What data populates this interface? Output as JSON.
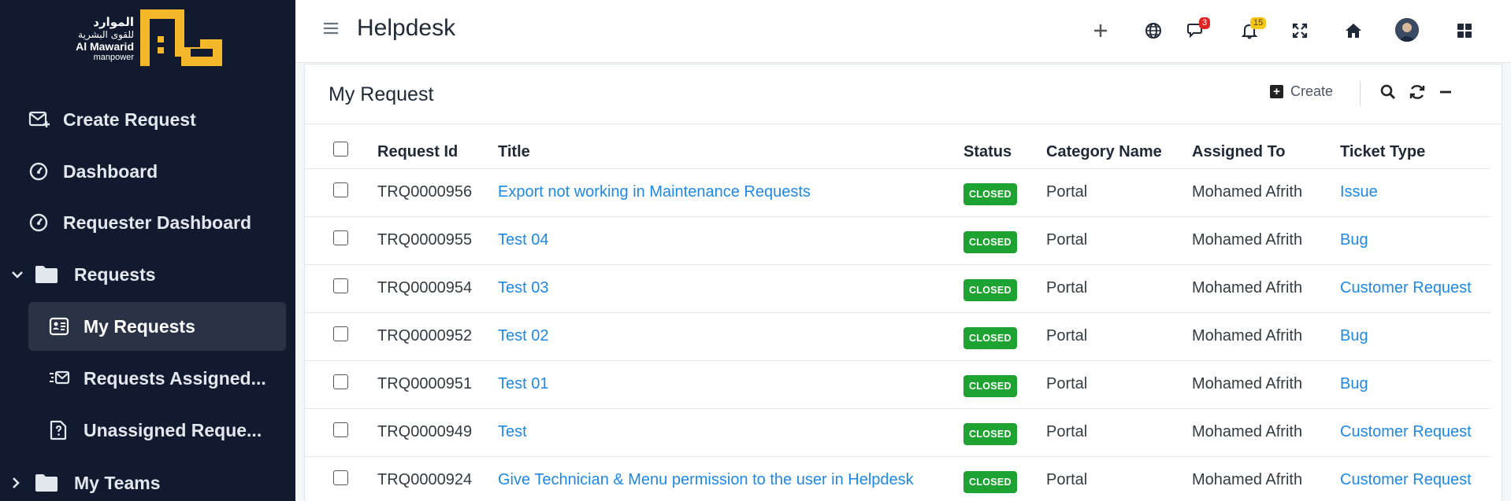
{
  "brand": {
    "arabic_line1": "الموارد",
    "arabic_line2": "للقوى البشرية",
    "english_line1": "Al Mawarid",
    "english_line2": "manpower",
    "color": "#f5b72a"
  },
  "sidebar": {
    "items": [
      {
        "label": "Create Request",
        "icon": "mail-plus-icon"
      },
      {
        "label": "Dashboard",
        "icon": "gauge-icon"
      },
      {
        "label": "Requester Dashboard",
        "icon": "gauge-icon"
      },
      {
        "label": "Requests",
        "icon": "folder-icon",
        "expanded": true
      },
      {
        "label": "My Requests",
        "icon": "id-card-icon",
        "active": true
      },
      {
        "label": "Requests Assigned...",
        "icon": "mail-fast-icon"
      },
      {
        "label": "Unassigned Reque...",
        "icon": "file-question-icon"
      },
      {
        "label": "My Teams",
        "icon": "folder-icon",
        "expanded": false
      }
    ]
  },
  "header": {
    "title": "Helpdesk",
    "messages_count": "3",
    "notifications_count": "15"
  },
  "card": {
    "title": "My Request",
    "create_label": "Create"
  },
  "table": {
    "columns": [
      "Request Id",
      "Title",
      "Status",
      "Category Name",
      "Assigned To",
      "Ticket Type"
    ],
    "rows": [
      {
        "id": "TRQ0000956",
        "title": "Export not working in Maintenance Requests",
        "status": "CLOSED",
        "category": "Portal",
        "assigned": "Mohamed Afrith",
        "type": "Issue"
      },
      {
        "id": "TRQ0000955",
        "title": "Test 04",
        "status": "CLOSED",
        "category": "Portal",
        "assigned": "Mohamed Afrith",
        "type": "Bug"
      },
      {
        "id": "TRQ0000954",
        "title": "Test 03",
        "status": "CLOSED",
        "category": "Portal",
        "assigned": "Mohamed Afrith",
        "type": "Customer Request"
      },
      {
        "id": "TRQ0000952",
        "title": "Test 02",
        "status": "CLOSED",
        "category": "Portal",
        "assigned": "Mohamed Afrith",
        "type": "Bug"
      },
      {
        "id": "TRQ0000951",
        "title": "Test 01",
        "status": "CLOSED",
        "category": "Portal",
        "assigned": "Mohamed Afrith",
        "type": "Bug"
      },
      {
        "id": "TRQ0000949",
        "title": "Test",
        "status": "CLOSED",
        "category": "Portal",
        "assigned": "Mohamed Afrith",
        "type": "Customer Request"
      },
      {
        "id": "TRQ0000924",
        "title": "Give Technician & Menu permission to the user in Helpdesk",
        "status": "CLOSED",
        "category": "Portal",
        "assigned": "Mohamed Afrith",
        "type": "Customer Request"
      }
    ]
  },
  "colors": {
    "sidebar_bg": "#111a2e",
    "active_bg": "#2a3346",
    "link": "#1e88e5",
    "status_closed": "#1ea332"
  }
}
